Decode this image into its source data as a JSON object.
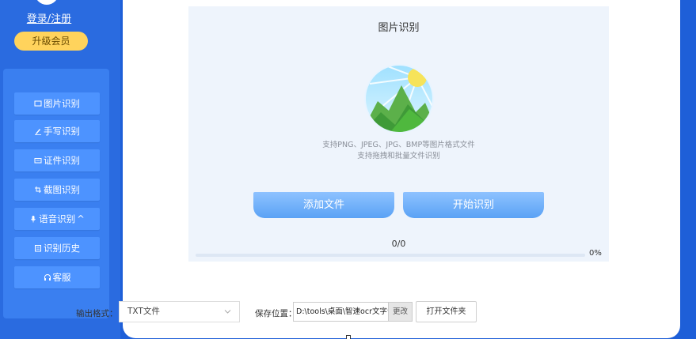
{
  "sidebar": {
    "login_label": "登录/注册",
    "vip_label": "升级会员",
    "items": [
      {
        "label": "图片识别",
        "icon": "image-icon"
      },
      {
        "label": "手写识别",
        "icon": "pen-icon"
      },
      {
        "label": "证件识别",
        "icon": "id-card-icon"
      },
      {
        "label": "截图识别",
        "icon": "crop-icon"
      },
      {
        "label": "语音识别",
        "icon": "microphone-icon",
        "badge": "^"
      },
      {
        "label": "识别历史",
        "icon": "history-icon"
      },
      {
        "label": "客服",
        "icon": "headset-icon"
      }
    ]
  },
  "main": {
    "title": "图片识别",
    "hint_line1": "支持PNG、JPEG、JPG、BMP等图片格式文件",
    "hint_line2": "支持拖拽和批量文件识别",
    "add_button": "添加文件",
    "start_button": "开始识别",
    "count": "0/0",
    "progress": {
      "value": 0,
      "label": "0%"
    }
  },
  "bottom": {
    "format_label": "输出格式：",
    "format_value": "TXT文件",
    "save_label": "保存位置：",
    "save_path": "D:\\tools\\桌面\\智速ocr文字识别",
    "change_button": "更改",
    "open_button": "打开文件夹"
  },
  "colors": {
    "background": "#1e5fd8",
    "sidebar": "#2a6be0",
    "menu_item": "#4d93ff",
    "vip": "#ffd35c",
    "button_gradient_top": "#8ec2ff",
    "button_gradient_bottom": "#5aa2f5"
  }
}
